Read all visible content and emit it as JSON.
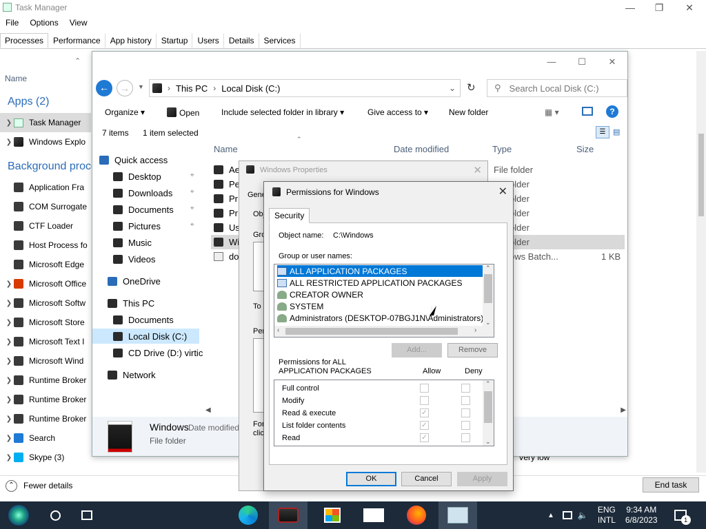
{
  "task_manager": {
    "title": "Task Manager",
    "menu": [
      "File",
      "Options",
      "View"
    ],
    "tabs": [
      "Processes",
      "Performance",
      "App history",
      "Startup",
      "Users",
      "Details",
      "Services"
    ],
    "active_tab": "Processes",
    "col_name": "Name",
    "section_apps": "Apps (2)",
    "section_bg": "Background proce",
    "apps": [
      "Task Manager",
      "Windows Explo"
    ],
    "bg_processes": [
      "Application Fra",
      "COM Surrogate",
      "CTF Loader",
      "Host Process fo",
      "Microsoft Edge",
      "Microsoft Office",
      "Microsoft Softw",
      "Microsoft Store",
      "Microsoft Text I",
      "Microsoft Wind",
      "Runtime Broker",
      "Runtime Broker",
      "Runtime Broker",
      "Search",
      "Skype (3)"
    ],
    "fewer_details": "Fewer details",
    "end_task": "End task",
    "very_low": "Very low"
  },
  "explorer": {
    "breadcrumb": [
      "This PC",
      "Local Disk (C:)"
    ],
    "search_placeholder": "Search Local Disk (C:)",
    "commands": {
      "organize": "Organize",
      "open": "Open",
      "include": "Include selected folder in library",
      "share": "Give access to",
      "new_folder": "New folder"
    },
    "status": {
      "items": "7 items",
      "selected": "1 item selected"
    },
    "nav": {
      "quick_access": "Quick access",
      "quick_items": [
        "Desktop",
        "Downloads",
        "Documents",
        "Pictures",
        "Music",
        "Videos"
      ],
      "onedrive": "OneDrive",
      "this_pc": "This PC",
      "pc_items": [
        "Documents",
        "Local Disk (C:)",
        "CD Drive (D:) virtic"
      ],
      "network": "Network"
    },
    "columns": {
      "name": "Name",
      "date": "Date modified",
      "type": "Type",
      "size": "Size"
    },
    "files": [
      "Ae",
      "Pe",
      "Pr",
      "Pr",
      "Us",
      "Wi",
      "do"
    ],
    "types": [
      "File folder",
      "older",
      "older",
      "older",
      "older",
      "older",
      "ows Batch..."
    ],
    "last_size": "1 KB",
    "details": {
      "name": "Windows",
      "date_label": "Date modified",
      "type": "File folder"
    }
  },
  "properties": {
    "title": "Windows Properties",
    "partial_labels": [
      "Gene",
      "Obj",
      "Gro",
      "To",
      "Per",
      "For",
      "clic"
    ]
  },
  "permissions": {
    "title": "Permissions for Windows",
    "tab": "Security",
    "object_label": "Object name:",
    "object_value": "C:\\Windows",
    "group_label": "Group or user names:",
    "groups": [
      "ALL APPLICATION PACKAGES",
      "ALL RESTRICTED APPLICATION PACKAGES",
      "CREATOR OWNER",
      "SYSTEM",
      "Administrators (DESKTOP-07BGJ1N\\Administrators)"
    ],
    "add": "Add...",
    "remove": "Remove",
    "perm_for": "Permissions for ALL",
    "perm_for2": "APPLICATION PACKAGES",
    "allow": "Allow",
    "deny": "Deny",
    "perms": [
      "Full control",
      "Modify",
      "Read & execute",
      "List folder contents",
      "Read"
    ],
    "allow_checked": [
      false,
      false,
      true,
      true,
      true
    ],
    "ok": "OK",
    "cancel": "Cancel",
    "apply": "Apply"
  },
  "taskbar": {
    "lang1": "ENG",
    "lang2": "INTL",
    "time": "9:34 AM",
    "date": "6/8/2023",
    "notif": "1"
  },
  "colors": {
    "accent": "#0078d7",
    "taskbar": "#1c2a3a",
    "section": "#2a6cb8"
  }
}
